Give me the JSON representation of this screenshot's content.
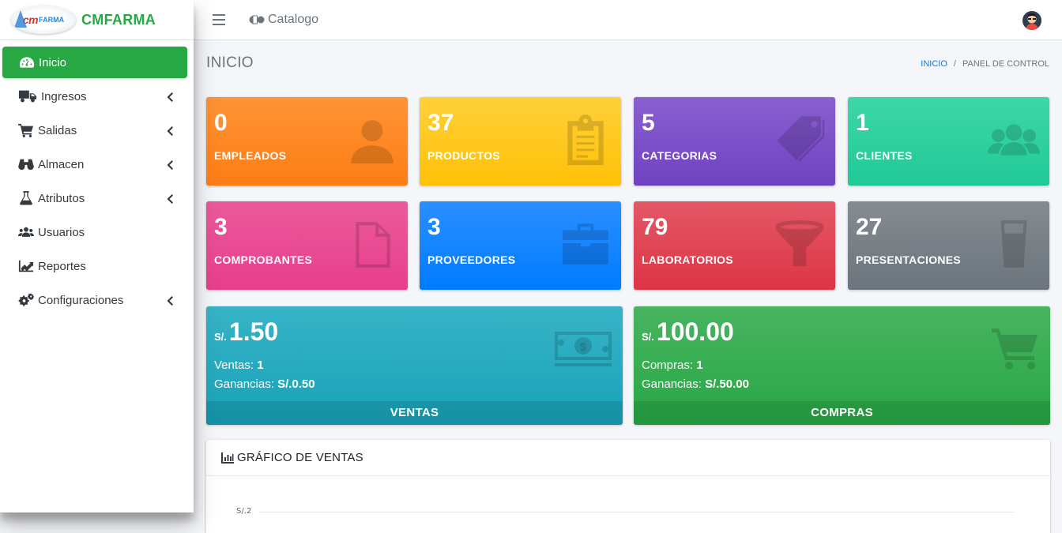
{
  "brand": {
    "logo_cm": "cm",
    "logo_farma": "FARMA",
    "name": "CMFARMA"
  },
  "sidebar": {
    "items": [
      {
        "label": "Inicio",
        "icon": "dashboard-gauge-icon",
        "active": true,
        "has_children": false
      },
      {
        "label": "Ingresos",
        "icon": "truck-icon",
        "active": false,
        "has_children": true
      },
      {
        "label": "Salidas",
        "icon": "cart-icon",
        "active": false,
        "has_children": true
      },
      {
        "label": "Almacen",
        "icon": "binoculars-icon",
        "active": false,
        "has_children": true
      },
      {
        "label": "Atributos",
        "icon": "flask-icon",
        "active": false,
        "has_children": true
      },
      {
        "label": "Usuarios",
        "icon": "users-icon",
        "active": false,
        "has_children": false
      },
      {
        "label": "Reportes",
        "icon": "line-chart-icon",
        "active": false,
        "has_children": false
      },
      {
        "label": "Configuraciones",
        "icon": "cogs-icon",
        "active": false,
        "has_children": true
      }
    ]
  },
  "topbar": {
    "catalog_label": "Catalogo"
  },
  "header": {
    "title": "INICIO",
    "breadcrumb": [
      "INICIO",
      "PANEL DE CONTROL"
    ],
    "separator": "/"
  },
  "stats": [
    {
      "value": "0",
      "label": "EMPLEADOS",
      "color": "#fd7e14",
      "icon": "user-icon"
    },
    {
      "value": "37",
      "label": "PRODUCTOS",
      "color": "#ffc107",
      "icon": "clipboard-icon"
    },
    {
      "value": "5",
      "label": "CATEGORIAS",
      "color": "#6f42c1",
      "icon": "tags-icon"
    },
    {
      "value": "1",
      "label": "CLIENTES",
      "color": "#20c997",
      "icon": "users-icon"
    },
    {
      "value": "3",
      "label": "COMPROBANTES",
      "color": "#e83e8c",
      "icon": "file-icon"
    },
    {
      "value": "3",
      "label": "PROVEEDORES",
      "color": "#007bff",
      "icon": "briefcase-icon"
    },
    {
      "value": "79",
      "label": "LABORATORIOS",
      "color": "#dc3545",
      "icon": "filter-icon"
    },
    {
      "value": "27",
      "label": "PRESENTACIONES",
      "color": "#6c757d",
      "icon": "glass-icon"
    }
  ],
  "ventas": {
    "currency": "S/.",
    "amount": "1.50",
    "count_label": "Ventas:",
    "count_value": "1",
    "profit_label": "Ganancias:",
    "profit_value": "S/.0.50",
    "footer": "VENTAS",
    "color": "#17a2b8",
    "icon": "money-bill-icon"
  },
  "compras": {
    "currency": "S/.",
    "amount": "100.00",
    "count_label": "Compras:",
    "count_value": "1",
    "profit_label": "Ganancias:",
    "profit_value": "S/.50.00",
    "footer": "COMPRAS",
    "color": "#28a745",
    "icon": "shopping-cart-icon"
  },
  "chart_card": {
    "title": "GRÁFICO DE VENTAS",
    "icon": "bar-chart-icon"
  },
  "chart_data": {
    "type": "bar",
    "title": "",
    "y_tick_labels": [
      "S/.2"
    ],
    "categories": [],
    "values": []
  }
}
